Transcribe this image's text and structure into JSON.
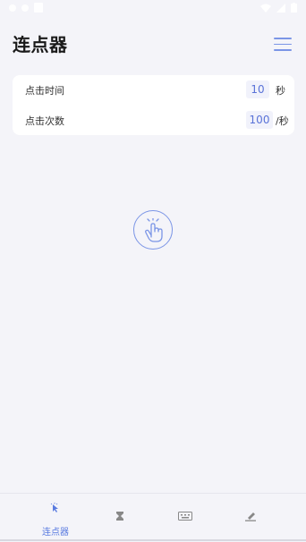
{
  "app": {
    "title": "连点器"
  },
  "settings": {
    "click_time_label": "点击时间",
    "click_time_value": "10",
    "click_time_unit": "秒",
    "click_count_label": "点击次数",
    "click_count_value": "100",
    "click_count_unit": "/秒"
  },
  "tabs": [
    {
      "label": "连点器",
      "icon": "tap-cursor-icon",
      "active": true
    },
    {
      "label": "",
      "icon": "hourglass-icon",
      "active": false
    },
    {
      "label": "",
      "icon": "keyboard-icon",
      "active": false
    },
    {
      "label": "",
      "icon": "pen-icon",
      "active": false
    }
  ],
  "colors": {
    "accent": "#7b95e6",
    "background": "#f4f4f9",
    "card": "#ffffff"
  }
}
